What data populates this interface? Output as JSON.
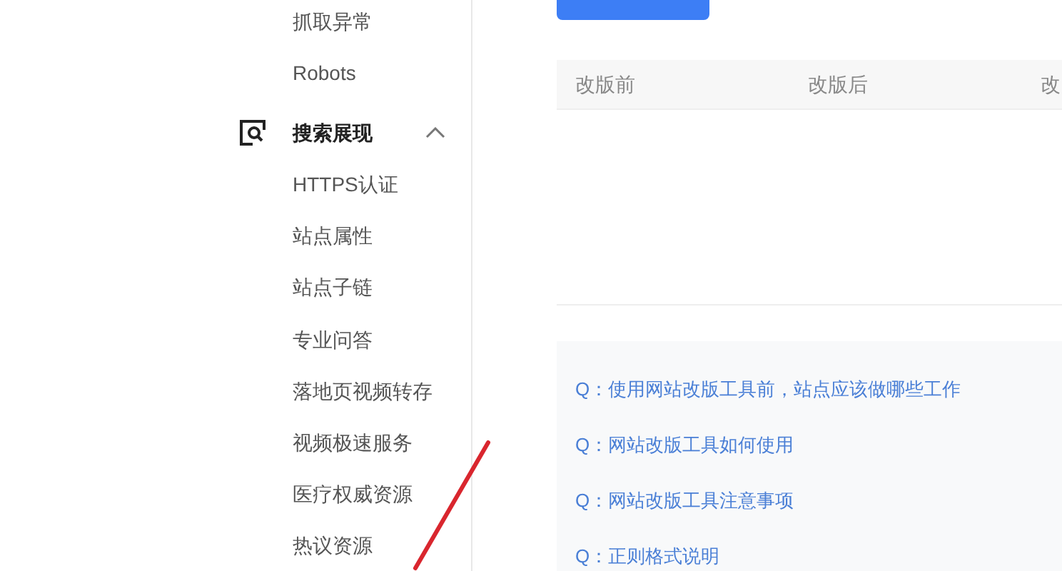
{
  "sidebar": {
    "items_before": [
      "抓取异常",
      "Robots"
    ],
    "group": {
      "label": "搜索展现",
      "expanded": true,
      "children": [
        "HTTPS认证",
        "站点属性",
        "站点子链",
        "专业问答",
        "落地页视频转存",
        "视频极速服务",
        "医疗权威资源",
        "热议资源"
      ]
    }
  },
  "table": {
    "columns": [
      "改版前",
      "改版后",
      "改"
    ]
  },
  "faq": [
    "Q：使用网站改版工具前，站点应该做哪些工作",
    "Q：网站改版工具如何使用",
    "Q：网站改版工具注意事项",
    "Q：正则格式说明"
  ]
}
